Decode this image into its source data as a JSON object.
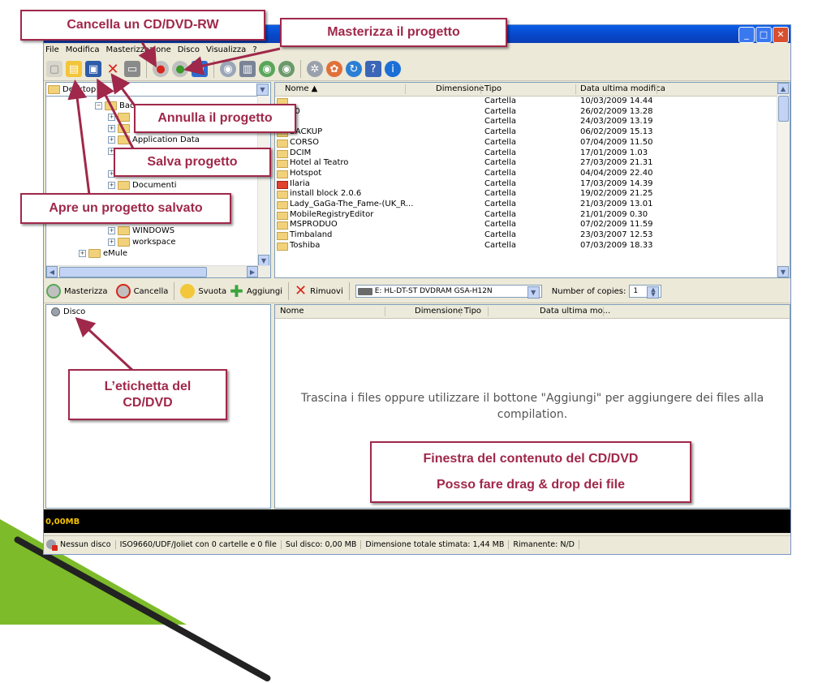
{
  "window": {
    "menu": [
      "File",
      "Modifica",
      "Masterizzazione",
      "Disco",
      "Visualizza",
      "?"
    ],
    "tree": {
      "combo": "Desktop",
      "items": [
        {
          "label": "Bac"
        },
        {
          "label": "Application Data"
        },
        {
          "label": "Documenti"
        },
        {
          "label": "WINDOWS"
        },
        {
          "label": "workspace"
        },
        {
          "label": "eMule"
        }
      ]
    },
    "filelist": {
      "headers": {
        "name": "Nome ▲",
        "size": "Dimensione",
        "type": "Tipo",
        "date": "Data ultima modifica"
      },
      "rows": [
        {
          "name": "",
          "type": "Cartella",
          "date": "10/03/2009 14.44",
          "icon": "folder"
        },
        {
          "name": "00",
          "type": "Cartella",
          "date": "26/02/2009 13.28",
          "icon": "folder"
        },
        {
          "name": "",
          "type": "Cartella",
          "date": "24/03/2009 13.19",
          "icon": "folder"
        },
        {
          "name": "BACKUP",
          "type": "Cartella",
          "date": "06/02/2009 15.13",
          "icon": "folder"
        },
        {
          "name": "CORSO",
          "type": "Cartella",
          "date": "07/04/2009 11.50",
          "icon": "folder"
        },
        {
          "name": "DCIM",
          "type": "Cartella",
          "date": "17/01/2009 1.03",
          "icon": "folder"
        },
        {
          "name": "Hotel al Teatro",
          "type": "Cartella",
          "date": "27/03/2009 21.31",
          "icon": "folder"
        },
        {
          "name": "Hotspot",
          "type": "Cartella",
          "date": "04/04/2009 22.40",
          "icon": "folder"
        },
        {
          "name": "Ilaria",
          "type": "Cartella",
          "date": "17/03/2009 14.39",
          "icon": "red"
        },
        {
          "name": "install block 2.0.6",
          "type": "Cartella",
          "date": "19/02/2009 21.25",
          "icon": "folder"
        },
        {
          "name": "Lady_GaGa-The_Fame-(UK_R...",
          "type": "Cartella",
          "date": "21/03/2009 13.01",
          "icon": "folder"
        },
        {
          "name": "MobileRegistryEditor",
          "type": "Cartella",
          "date": "21/01/2009 0.30",
          "icon": "folder"
        },
        {
          "name": "MSPRODUO",
          "type": "Cartella",
          "date": "07/02/2009 11.59",
          "icon": "folder"
        },
        {
          "name": "Timbaland",
          "type": "Cartella",
          "date": "23/03/2007 12.53",
          "icon": "folder"
        },
        {
          "name": "Toshiba",
          "type": "Cartella",
          "date": "07/03/2009 18.33",
          "icon": "folder"
        }
      ]
    },
    "compilation_toolbar": {
      "burn": "Masterizza",
      "erase": "Cancella",
      "empty": "Svuota",
      "add": "Aggiungi",
      "remove": "Rimuovi",
      "drive": "E: HL-DT-ST DVDRAM GSA-H12N",
      "copies_label": "Number of copies:",
      "copies": "1"
    },
    "disc_tree": {
      "label": "Disco"
    },
    "disc_content": {
      "headers": {
        "name": "Nome",
        "size": "Dimensione",
        "type": "Tipo",
        "date": "Data ultima mo..."
      },
      "hint": "Trascina i files oppure utilizzare il bottone \"Aggiungi\" per aggiungere dei files alla compilation."
    },
    "capacity": "0,00MB",
    "status": [
      "Nessun disco",
      "ISO9660/UDF/Joliet con 0 cartelle e 0 file",
      "Sul disco: 0,00 MB",
      "Dimensione totale stimata: 1,44 MB",
      "Rimanente: N/D"
    ]
  },
  "callouts": {
    "erase_rw": "Cancella un CD/DVD-RW",
    "burn_project": "Masterizza il progetto",
    "cancel_project": "Annulla il progetto",
    "save_project": "Salva progetto",
    "open_project": "Apre un progetto salvato",
    "disc_label_1": "L’etichetta del",
    "disc_label_2": "CD/DVD",
    "content_window_1": "Finestra del contenuto del CD/DVD",
    "content_window_2": "Posso fare drag & drop dei file"
  },
  "colors": {
    "callout": "#a0284a",
    "titlebar": "#0a4fd6",
    "capacity_text": "#f5c200"
  }
}
